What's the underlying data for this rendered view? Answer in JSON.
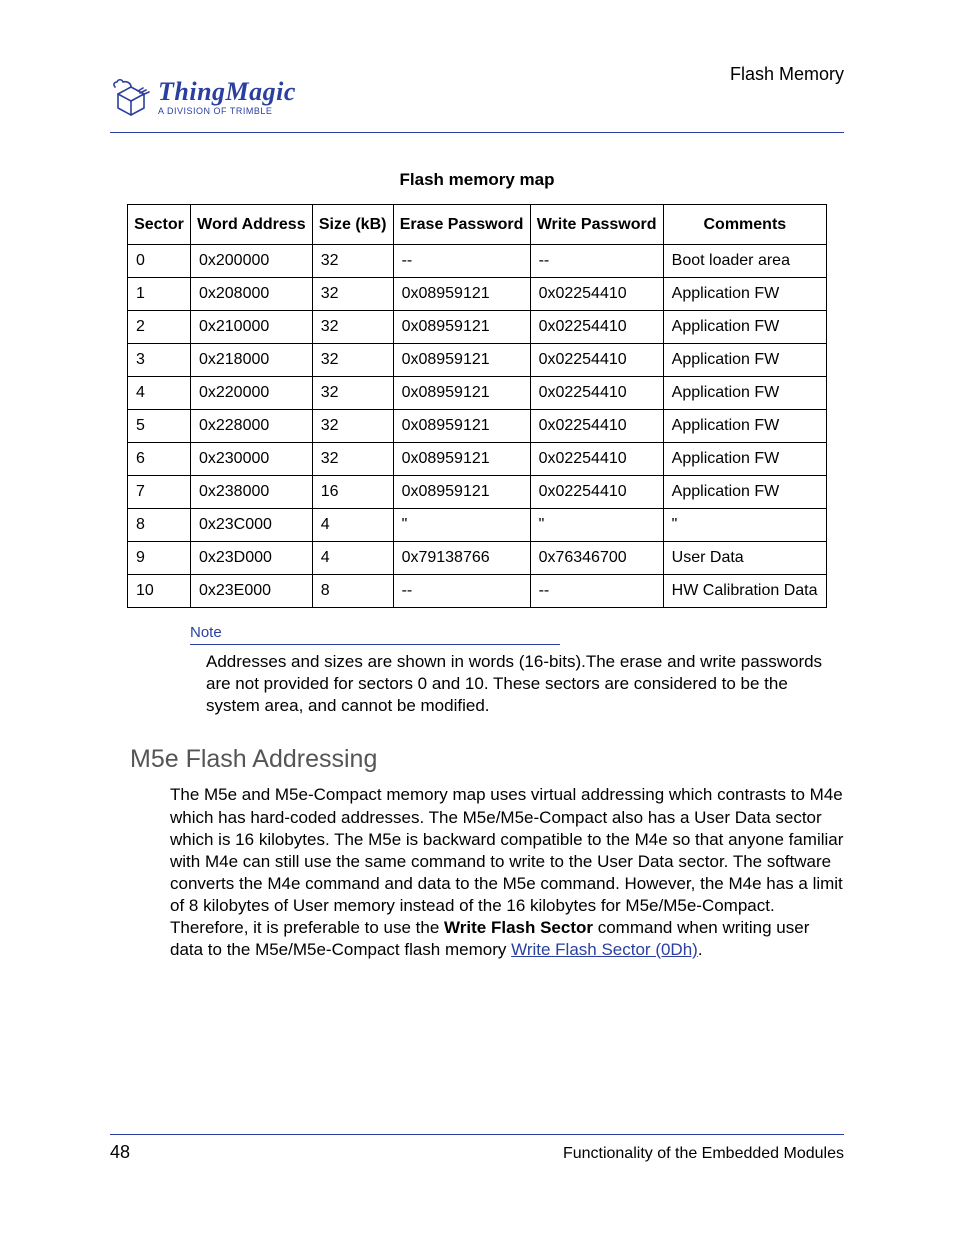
{
  "header": {
    "section_title": "Flash Memory",
    "logo_brand": "ThingMagic",
    "logo_sub": "A DIVISION OF TRIMBLE"
  },
  "table_caption": "Flash memory map",
  "table": {
    "headers": {
      "sector": "Sector",
      "word_address": "Word Address",
      "size": "Size (kB)",
      "erase_pw": "Erase Password",
      "write_pw": "Write Password",
      "comments": "Comments"
    },
    "rows": [
      {
        "sector": "0",
        "addr": "0x200000",
        "size": "32",
        "erase": "--",
        "write": "--",
        "comments": "Boot loader area"
      },
      {
        "sector": "1",
        "addr": "0x208000",
        "size": "32",
        "erase": "0x08959121",
        "write": "0x02254410",
        "comments": "Application FW"
      },
      {
        "sector": "2",
        "addr": "0x210000",
        "size": "32",
        "erase": "0x08959121",
        "write": "0x02254410",
        "comments": "Application FW"
      },
      {
        "sector": "3",
        "addr": "0x218000",
        "size": "32",
        "erase": "0x08959121",
        "write": "0x02254410",
        "comments": "Application FW"
      },
      {
        "sector": "4",
        "addr": "0x220000",
        "size": "32",
        "erase": "0x08959121",
        "write": "0x02254410",
        "comments": "Application FW"
      },
      {
        "sector": "5",
        "addr": "0x228000",
        "size": "32",
        "erase": "0x08959121",
        "write": "0x02254410",
        "comments": "Application FW"
      },
      {
        "sector": "6",
        "addr": "0x230000",
        "size": "32",
        "erase": "0x08959121",
        "write": "0x02254410",
        "comments": "Application FW"
      },
      {
        "sector": "7",
        "addr": "0x238000",
        "size": "16",
        "erase": "0x08959121",
        "write": "0x02254410",
        "comments": "Application FW"
      },
      {
        "sector": "8",
        "addr": "0x23C000",
        "size": "4",
        "erase": "\"",
        "write": "\"",
        "comments": "\""
      },
      {
        "sector": "9",
        "addr": "0x23D000",
        "size": "4",
        "erase": "0x79138766",
        "write": "0x76346700",
        "comments": "User Data"
      },
      {
        "sector": "10",
        "addr": "0x23E000",
        "size": "8",
        "erase": "--",
        "write": "--",
        "comments": "HW Calibration Data"
      }
    ]
  },
  "note": {
    "label": "Note",
    "body": "Addresses and sizes are shown in words (16-bits).The erase and write passwords are not provided for sectors 0 and 10. These sectors are considered to be the system area, and cannot be modified."
  },
  "section_heading": "M5e Flash Addressing",
  "body": {
    "pre": "The M5e and M5e-Compact memory map uses virtual addressing which contrasts to M4e which has hard-coded addresses. The M5e/M5e-Compact also has a User Data sector which is 16 kilobytes. The M5e is backward compatible to the M4e so that anyone familiar with M4e can still use the same command to write to the User Data sector. The software converts the M4e command and data to the M5e command. However, the M4e has a limit of 8 kilobytes of User memory instead of the 16 kilobytes for M5e/M5e-Compact. Therefore, it is preferable to use the ",
    "bold": "Write Flash Sector",
    "mid": " command when writing user data to the M5e/M5e-Compact flash memory ",
    "link": "Write Flash Sector (0Dh)",
    "post": "."
  },
  "footer": {
    "page_number": "48",
    "right": "Functionality of the Embedded Modules"
  }
}
